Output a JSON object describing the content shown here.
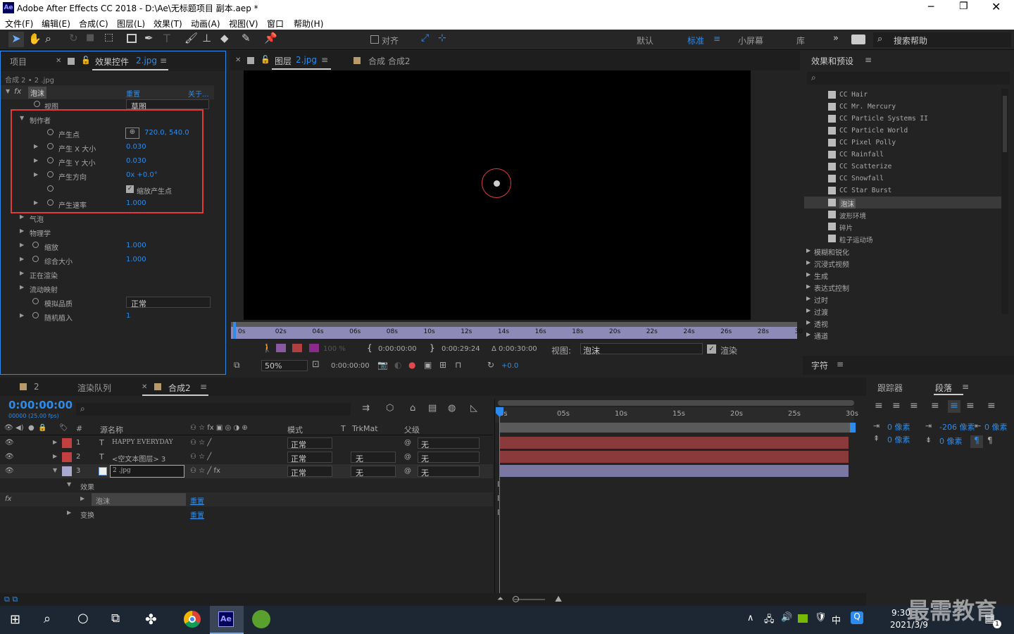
{
  "app": {
    "title": "Adobe After Effects CC 2018 - D:\\Ae\\无标题项目 副本.aep *",
    "logo": "Ae"
  },
  "menu": [
    "文件(F)",
    "编辑(E)",
    "合成(C)",
    "图层(L)",
    "效果(T)",
    "动画(A)",
    "视图(V)",
    "窗口",
    "帮助(H)"
  ],
  "toolbar": {
    "align": "对齐",
    "workspaces": [
      "默认",
      "标准",
      "小屏幕",
      "库"
    ],
    "search_placeholder": "搜索帮助"
  },
  "effects_panel": {
    "tab_project": "项目",
    "tab_effects": "效果控件",
    "tab_effects_file": "2.jpg",
    "breadcrumb": "合成 2 • 2 .jpg",
    "effect_name": "泡沫",
    "reset": "重置",
    "about": "关于...",
    "view_label": "视图",
    "view_value": "草图",
    "producer": "制作者",
    "params": [
      {
        "label": "产生点",
        "value": "720.0, 540.0"
      },
      {
        "label": "产生 X 大小",
        "value": "0.030"
      },
      {
        "label": "产生 Y 大小",
        "value": "0.030"
      },
      {
        "label": "产生方向",
        "value": "0x +0.0°"
      },
      {
        "label": "",
        "value": "缩放产生点"
      },
      {
        "label": "产生速率",
        "value": "1.000"
      }
    ],
    "groups": [
      "气泡",
      "物理学"
    ],
    "zoom_label": "缩放",
    "zoom_value": "1.000",
    "overall_size_label": "综合大小",
    "overall_size_value": "1.000",
    "render_label": "正在渲染",
    "flow_label": "流动映射",
    "quality_label": "模拟品质",
    "quality_value": "正常",
    "seed_label": "随机植入",
    "seed_value": "1"
  },
  "viewer": {
    "tab_layer": "图层",
    "tab_layer_file": "2.jpg",
    "tab_comp": "合成 合成2",
    "ruler": [
      "0s",
      "02s",
      "04s",
      "06s",
      "08s",
      "10s",
      "12s",
      "14s",
      "16s",
      "18s",
      "20s",
      "22s",
      "24s",
      "26s",
      "28s",
      "30s"
    ],
    "opacity": "100 %",
    "time_in": "0:00:00:00",
    "time_out": "0:00:29:24",
    "duration": "Δ 0:00:30:00",
    "view_label": "视图:",
    "view_value": "泡沫",
    "render_label": "渲染",
    "zoom": "50%",
    "current_time": "0:00:00:00",
    "exposure": "+0.0"
  },
  "effects_presets": {
    "title": "效果和预设",
    "items": [
      "CC Hair",
      "CC Mr. Mercury",
      "CC Particle Systems II",
      "CC Particle World",
      "CC Pixel Polly",
      "CC Rainfall",
      "CC Scatterize",
      "CC Snowfall",
      "CC Star Burst",
      "泡沫",
      "波形环境",
      "碎片",
      "粒子运动场"
    ],
    "categories": [
      "模糊和锐化",
      "沉浸式视频",
      "生成",
      "表达式控制",
      "过时",
      "过渡",
      "透视",
      "通道"
    ]
  },
  "character_panel": {
    "title": "字符"
  },
  "timeline": {
    "tab_1": "2",
    "tab_render": "渲染队列",
    "tab_comp": "合成2",
    "timecode": "0:00:00:00",
    "fps": "00000 (25.00 fps)",
    "headers": {
      "num": "#",
      "source": "源名称",
      "mode": "模式",
      "t": "T",
      "trkmat": "TrkMat",
      "parent": "父级"
    },
    "layers": [
      {
        "num": "1",
        "type": "T",
        "name": "HAPPY EVERYDAY",
        "mode": "正常",
        "trkmat": "",
        "parent": "无",
        "color": "#c24040"
      },
      {
        "num": "2",
        "type": "T",
        "name": "<空文本图层> 3",
        "mode": "正常",
        "trkmat": "无",
        "parent": "无",
        "color": "#c24040"
      },
      {
        "num": "3",
        "type": "img",
        "name": "2 .jpg",
        "mode": "正常",
        "trkmat": "无",
        "parent": "无",
        "color": "#a9a9d0"
      }
    ],
    "effects_label": "效果",
    "effect_item": "泡沫",
    "transform_label": "变换",
    "reset": "重置",
    "ruler": [
      "0s",
      "05s",
      "10s",
      "15s",
      "20s",
      "25s",
      "30s"
    ]
  },
  "right_bottom": {
    "tab_tracker": "跟踪器",
    "tab_paragraph": "段落",
    "indent_left": "0 像素",
    "indent_first": "-206 像素",
    "indent_right": "0 像素",
    "space_before": "0 像素",
    "space_after": "0 像素"
  },
  "taskbar": {
    "time": "9:30",
    "date": "2021/3/9",
    "ime": "中",
    "watermark": "最需教育",
    "notif": "1"
  }
}
